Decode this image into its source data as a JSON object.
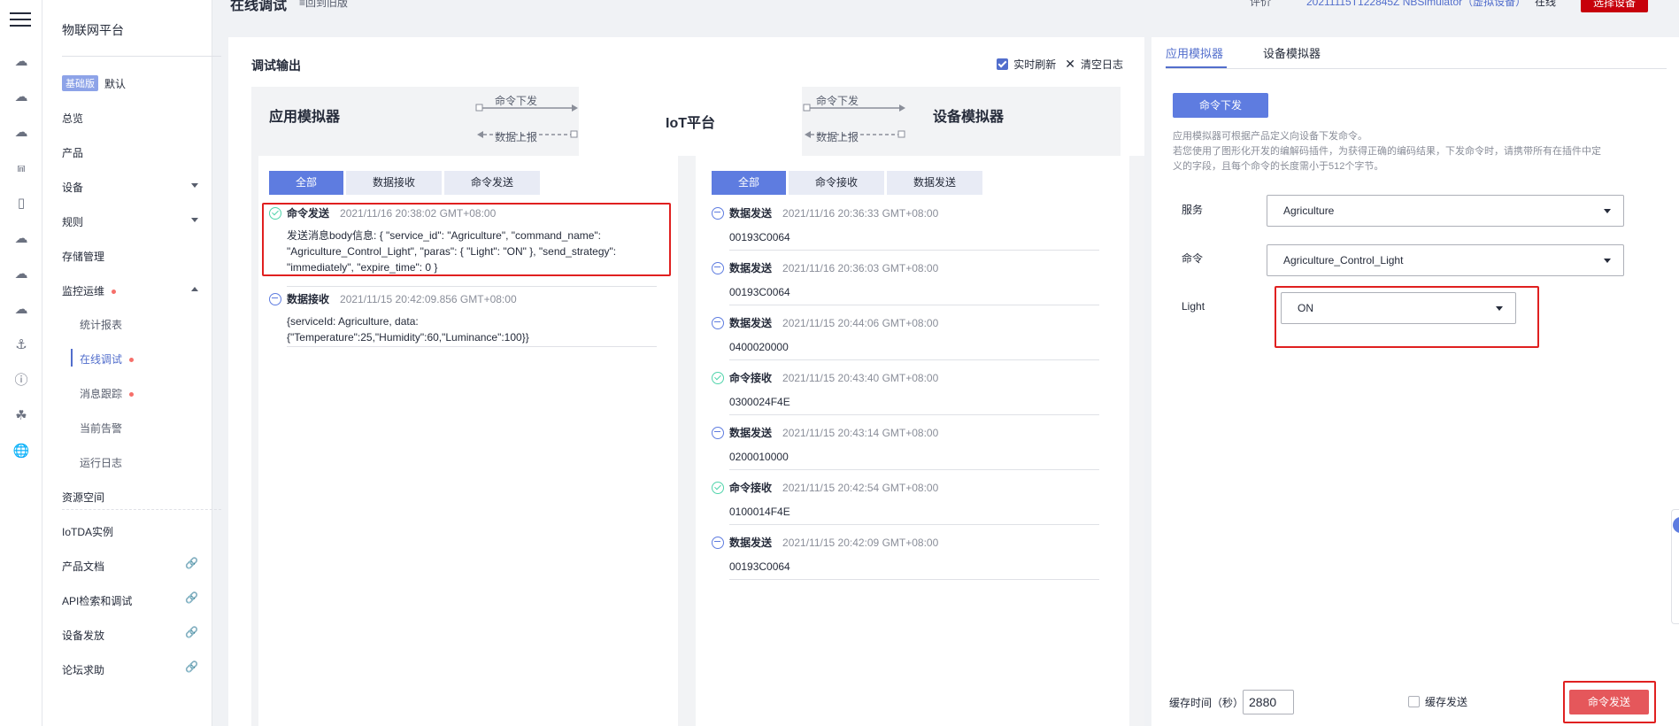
{
  "topbar": {
    "page_title": "在线调试",
    "back_link": "≡回到旧版",
    "device_label": "评价",
    "device_name": "20211115T122845Z NBSimulator（虚拟设备）",
    "status": "在线",
    "select_device_button": "选择设备"
  },
  "sidebar": {
    "title": "物联网平台",
    "edition_badge": "基础版",
    "edition_default": "默认",
    "items": [
      {
        "label": "总览"
      },
      {
        "label": "产品"
      },
      {
        "label": "设备"
      },
      {
        "label": "规则"
      },
      {
        "label": "存储管理"
      },
      {
        "label": "监控运维"
      },
      {
        "label": "资源空间"
      },
      {
        "label": "IoTDA实例"
      },
      {
        "label": "产品文档"
      },
      {
        "label": "API检索和调试"
      },
      {
        "label": "设备发放"
      },
      {
        "label": "论坛求助"
      }
    ],
    "subitems": [
      {
        "label": "统计报表"
      },
      {
        "label": "在线调试"
      },
      {
        "label": "消息跟踪"
      },
      {
        "label": "当前告警"
      },
      {
        "label": "运行日志"
      }
    ]
  },
  "debug": {
    "title": "调试输出",
    "realtime_refresh": "实时刷新",
    "clear_log": "清空日志",
    "diagram": {
      "app_sim": "应用模拟器",
      "iot_platform": "IoT平台",
      "device_sim": "设备模拟器",
      "cmd_down_left": "命令下发",
      "data_up_left": "数据上报",
      "cmd_down_right": "命令下发",
      "data_up_right": "数据上报"
    },
    "app_tabs": [
      "全部",
      "数据接收",
      "命令发送"
    ],
    "device_tabs": [
      "全部",
      "命令接收",
      "数据发送"
    ],
    "app_log": [
      {
        "type": "命令发送",
        "time": "2021/11/16 20:38:02 GMT+08:00",
        "status": "ok",
        "lines": [
          "发送消息body信息: { \"service_id\": \"Agriculture\", \"command_name\":",
          "\"Agriculture_Control_Light\", \"paras\": { \"Light\": \"ON\" }, \"send_strategy\":",
          "\"immediately\", \"expire_time\": 0 }"
        ]
      },
      {
        "type": "数据接收",
        "time": "2021/11/15 20:42:09.856 GMT+08:00",
        "status": "sync",
        "lines": [
          "{serviceId: Agriculture, data:",
          "{\"Temperature\":25,\"Humidity\":60,\"Luminance\":100}}"
        ]
      }
    ],
    "device_log": [
      {
        "type": "数据发送",
        "time": "2021/11/16 20:36:33 GMT+08:00",
        "status": "sync",
        "value": "00193C0064"
      },
      {
        "type": "数据发送",
        "time": "2021/11/16 20:36:03 GMT+08:00",
        "status": "sync",
        "value": "00193C0064"
      },
      {
        "type": "数据发送",
        "time": "2021/11/15 20:44:06 GMT+08:00",
        "status": "sync",
        "value": "0400020000"
      },
      {
        "type": "命令接收",
        "time": "2021/11/15 20:43:40 GMT+08:00",
        "status": "ok",
        "value": "0300024F4E"
      },
      {
        "type": "数据发送",
        "time": "2021/11/15 20:43:14 GMT+08:00",
        "status": "sync",
        "value": "0200010000"
      },
      {
        "type": "命令接收",
        "time": "2021/11/15 20:42:54 GMT+08:00",
        "status": "ok",
        "value": "0100014F4E"
      },
      {
        "type": "数据发送",
        "time": "2021/11/15 20:42:09 GMT+08:00",
        "status": "sync",
        "value": "00193C0064"
      }
    ]
  },
  "right_panel": {
    "tabs": [
      "应用模拟器",
      "设备模拟器"
    ],
    "cmd_button": "命令下发",
    "desc_lines": [
      "应用模拟器可根据产品定义向设备下发命令。",
      "若您使用了图形化开发的编解码插件，为获得正确的编码结果，下发命令时，请携带所有在插件中定",
      "义的字段，且每个命令的长度需小于512个字节。"
    ],
    "service_label": "服务",
    "service_value": "Agriculture",
    "command_label": "命令",
    "command_value": "Agriculture_Control_Light",
    "light_label": "Light",
    "light_value": "ON",
    "cache_label": "缓存时间（秒）",
    "cache_value": "2880",
    "cache_send_label": "缓存发送",
    "send_button": "命令发送"
  }
}
